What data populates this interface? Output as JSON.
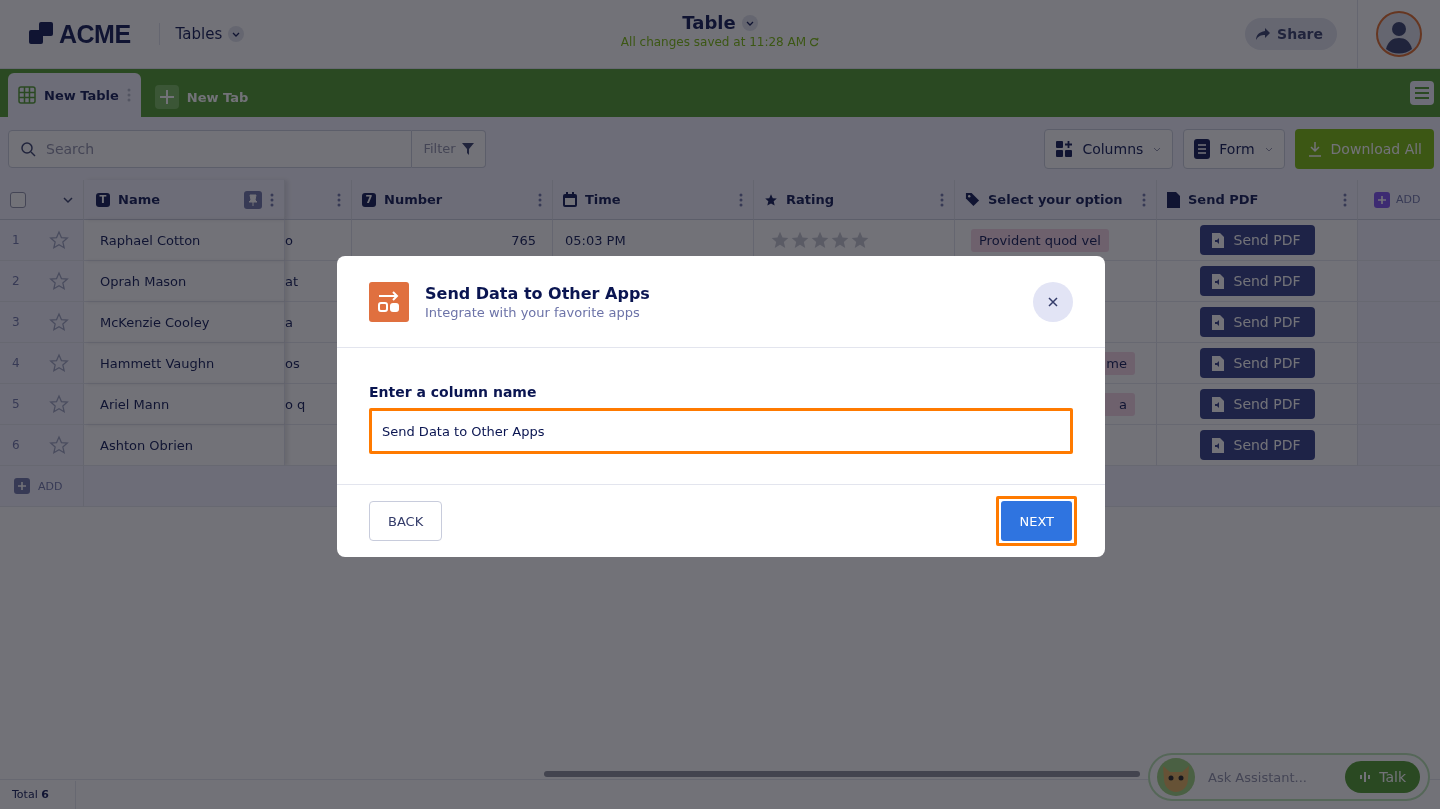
{
  "header": {
    "logo": "ACME",
    "app_menu": "Tables",
    "title": "Table",
    "save_status": "All changes saved at 11:28 AM",
    "share": "Share"
  },
  "tabs": [
    {
      "label": "New Table",
      "selected": true
    },
    {
      "label": "New Tab",
      "selected": false
    }
  ],
  "toolbar": {
    "search": {
      "placeholder": "Search"
    },
    "filter": "Filter",
    "columns": "Columns",
    "form": "Form",
    "download": "Download All"
  },
  "table": {
    "select_all": {
      "checked": false
    },
    "columns": [
      {
        "kind": "text",
        "label": "Name",
        "icon_text": "T"
      },
      {
        "kind": "cut"
      },
      {
        "kind": "number",
        "label": "Number",
        "icon_text": "7"
      },
      {
        "kind": "time",
        "label": "Time"
      },
      {
        "kind": "rating",
        "label": "Rating"
      },
      {
        "kind": "option",
        "label": "Select your option"
      },
      {
        "kind": "pdf",
        "label": "Send PDF"
      }
    ],
    "add_column": "ADD",
    "rows": [
      {
        "index": "1",
        "starred": false,
        "name": "Raphael Cotton",
        "column_2": "o",
        "number": "765",
        "time": "05:03 PM",
        "stars": 0,
        "option": "Provident quod vel",
        "button": "Send PDF"
      },
      {
        "index": "2",
        "starred": false,
        "name": "Oprah Mason",
        "column_2": "at",
        "button": "Send PDF"
      },
      {
        "index": "3",
        "starred": false,
        "name": "McKenzie Cooley",
        "column_2": "a",
        "button": "Send PDF"
      },
      {
        "index": "4",
        "starred": false,
        "name": "Hammett Vaughn",
        "column_2": "os",
        "option": "me",
        "option_cut": true,
        "button": "Send PDF"
      },
      {
        "index": "5",
        "starred": false,
        "name": "Ariel Mann",
        "column_2": "o q",
        "option": "a",
        "option_cut": true,
        "button": "Send PDF"
      },
      {
        "index": "6",
        "starred": false,
        "name": "Ashton Obrien",
        "button": "Send PDF"
      }
    ],
    "add_row": "ADD"
  },
  "status_bar": {
    "total": "Total **6**"
  },
  "assistant": {
    "placeholder": "Ask Assistant...",
    "talk": "Talk"
  },
  "dialog": {
    "title": "Send Data to Other Apps",
    "subtitle": "Integrate with your favorite apps",
    "field_label": "Enter a column name",
    "field_value": "Send Data to Other Apps",
    "back": "BACK",
    "next": "NEXT"
  }
}
